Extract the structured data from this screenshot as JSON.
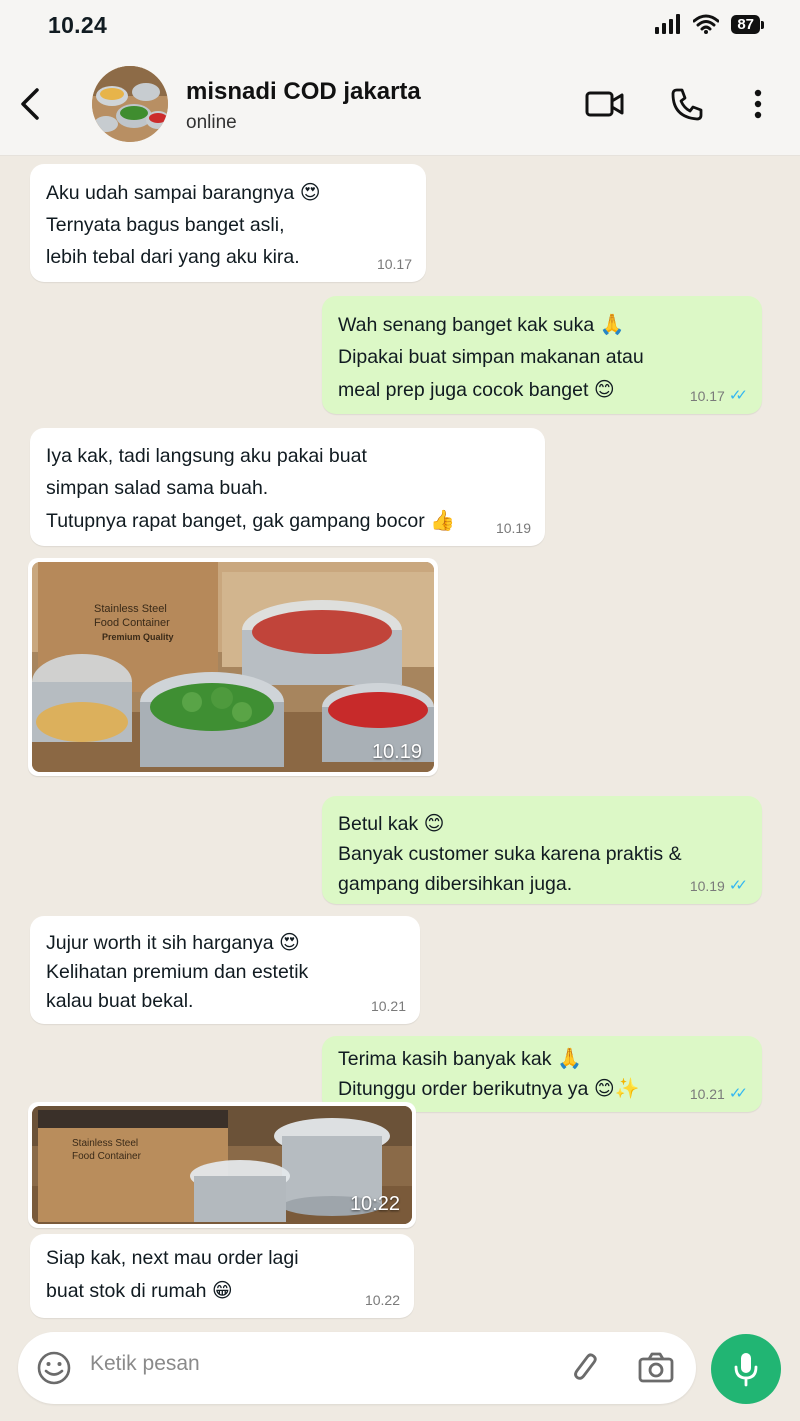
{
  "status": {
    "time": "10.24",
    "battery": "87"
  },
  "contact": {
    "name": "misnadi COD jakarta",
    "status": "online"
  },
  "messages": [
    {
      "lines": [
        "Aku udah sampai barangnya",
        "Ternyata bagus banget asli,",
        "lebih tebal dari yang aku kira."
      ],
      "emoji": "😍",
      "time": "10.17"
    },
    {
      "lines": [
        "Wah senang banget kak suka",
        "Dipakai buat simpan makanan atau",
        "meal prep juga cocok banget"
      ],
      "emoji1": "🙏",
      "emoji2": "😊",
      "time": "10.17"
    },
    {
      "lines": [
        "Iya kak, tadi langsung aku pakai buat",
        "simpan salad sama buah.",
        "Tutupnya rapat banget, gak gampang bocor"
      ],
      "emoji": "👍",
      "time": "10.19"
    },
    {
      "photo_time": "10.19",
      "box_text": [
        "Stainless Steel",
        "Food Container",
        "Premium Quality"
      ]
    },
    {
      "lines": [
        "Betul kak",
        "Banyak customer suka karena praktis &",
        "gampang dibersihkan juga."
      ],
      "emoji": "😊",
      "time": "10.19"
    },
    {
      "lines": [
        "Jujur worth it sih harganya",
        "Kelihatan premium dan estetik",
        "kalau buat bekal."
      ],
      "emoji": "😍",
      "time": "10.21"
    },
    {
      "lines": [
        "Terima kasih banyak kak",
        "Ditunggu order berikutnya ya"
      ],
      "emoji1": "🙏",
      "emoji2": "😊✨",
      "time": "10.21"
    },
    {
      "photo_time": "10:22",
      "box_text": [
        "Stainless Steel",
        "Food Container"
      ]
    },
    {
      "lines": [
        "Siap kak, next mau order lagi",
        "buat stok di rumah"
      ],
      "emoji": "😁",
      "time": "10.22"
    }
  ],
  "input": {
    "placeholder": "Ketik pesan"
  },
  "colors": {
    "incoming": "#ffffff",
    "outgoing": "#dcf8c6",
    "accent": "#21b573",
    "ticks": "#34b7f1",
    "background": "#efeae2"
  },
  "icons": [
    "back-arrow-icon",
    "video-call-icon",
    "phone-icon",
    "more-vert-icon",
    "emoji-icon",
    "attach-icon",
    "camera-icon",
    "mic-icon"
  ]
}
